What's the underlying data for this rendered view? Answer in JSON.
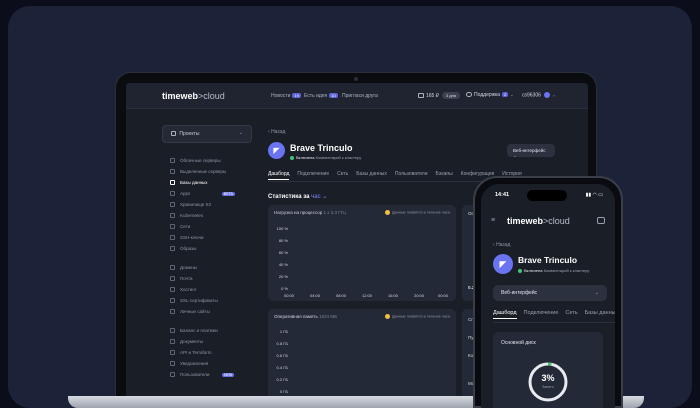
{
  "app": {
    "logo_main": "timeweb",
    "logo_sub": ">cloud"
  },
  "topbar": {
    "nav": [
      {
        "label": "Новости",
        "badge": "19"
      },
      {
        "label": "Есть идея",
        "badge": "10"
      },
      {
        "label": "Пригласи друга",
        "badge": ""
      }
    ],
    "balance": "165 ₽",
    "balance_days": "3 дня",
    "support": "Поддержка",
    "support_badge": "2",
    "account": "cs96306"
  },
  "sidebar": {
    "project": "Проекты",
    "items": [
      {
        "label": "Облачные серверы",
        "badge": ""
      },
      {
        "label": "Выделенные серверы",
        "badge": ""
      },
      {
        "label": "Базы данных",
        "badge": "",
        "active": true
      },
      {
        "label": "Apps",
        "badge": "BETA"
      },
      {
        "label": "Хранилище S3",
        "badge": ""
      },
      {
        "label": "Kubernetes",
        "badge": ""
      },
      {
        "label": "Сети",
        "badge": ""
      },
      {
        "label": "SSH-ключи",
        "badge": ""
      },
      {
        "label": "Образы",
        "badge": ""
      }
    ],
    "items2": [
      {
        "label": "Домены"
      },
      {
        "label": "Почта"
      },
      {
        "label": "Хостинг"
      },
      {
        "label": "SSL-сертификаты"
      },
      {
        "label": "Личные сайты"
      }
    ],
    "items3": [
      {
        "label": "Баланс и платежи",
        "badge": ""
      },
      {
        "label": "Документы",
        "badge": ""
      },
      {
        "label": "API и Terraform",
        "badge": ""
      },
      {
        "label": "Уведомления",
        "badge": ""
      },
      {
        "label": "Пользователи",
        "badge": "NEW"
      }
    ]
  },
  "main": {
    "back": "Назад",
    "server_name": "Brave Trinculo",
    "status_label": "Включена",
    "status_comment": "Комментарий к кластеру",
    "web_button": "Веб-интерфейс",
    "tabs": [
      "Дашборд",
      "Подключение",
      "Сеть",
      "Базы данных",
      "Пользователи",
      "Бэкапы",
      "Конфигурация",
      "История"
    ],
    "stat_title": "Статистика за",
    "stat_period": "час",
    "cpu_card": {
      "title": "Нагрузка на процессор",
      "subtitle": "1 x 3.3 ГГц",
      "note": "Данные появятся в течение часа",
      "yticks": [
        "100 %",
        "80 %",
        "60 %",
        "40 %",
        "20 %",
        "0 %"
      ],
      "xticks": [
        "00:00",
        "04:00",
        "08:00",
        "12:00",
        "16:00",
        "20:00",
        "00:00"
      ]
    },
    "ram_card": {
      "title": "Оперативная память",
      "subtitle": "1024 МБ",
      "note": "Данные появятся в течение часа",
      "yticks": [
        "1 ГБ",
        "0.8 ГБ",
        "0.6 ГБ",
        "0.4 ГБ",
        "0.2 ГБ",
        "0 ГБ"
      ]
    },
    "right_card1": {
      "title": "Основной",
      "value": "0.2"
    },
    "right_card2": {
      "rows": [
        "Способ",
        "Публ",
        "Комм",
        "Мс г.с"
      ]
    }
  },
  "phone": {
    "time": "14:41",
    "back": "Назад",
    "server_name": "Brave Trinculo",
    "status_label": "Включена",
    "status_comment": "Комментарий к кластеру",
    "web_button": "Веб-интерфейс",
    "tabs": [
      "Дашборд",
      "Подключение",
      "Сеть",
      "Базы данны"
    ],
    "disk_title": "Основной диск",
    "disk_value": "3%",
    "disk_label": "Занято",
    "disk_fraction": 0.03
  },
  "colors": {
    "accent": "#6b74f0",
    "status_ok": "#46c27a",
    "note_dot": "#f0c040"
  }
}
